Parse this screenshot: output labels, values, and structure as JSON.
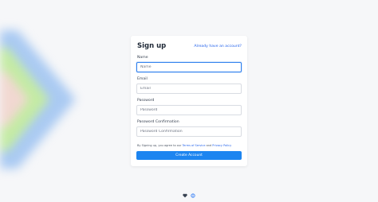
{
  "form": {
    "title": "Sign up",
    "signin_link": "Already have an account?",
    "fields": {
      "name": {
        "label": "Name",
        "placeholder": "Name",
        "value": ""
      },
      "email": {
        "label": "Email",
        "placeholder": "Email",
        "value": ""
      },
      "password": {
        "label": "Password",
        "placeholder": "Password",
        "value": ""
      },
      "password_confirmation": {
        "label": "Password Confirmation",
        "placeholder": "Password Confirmation",
        "value": ""
      }
    },
    "terms": {
      "prefix": "By Signing up, you agree to our ",
      "tos_link": "Terms of Service",
      "conjunction": " and ",
      "privacy_link": "Privacy Policy"
    },
    "submit_label": "Create Account"
  },
  "footer": {
    "icons": [
      "heart-icon",
      "globe-icon"
    ]
  },
  "colors": {
    "accent": "#1d85f0",
    "link": "#2563eb",
    "background": "#f6f7f9",
    "deco_blue": "#7fb3ee",
    "deco_green": "#c8ef9c",
    "deco_pink": "#f6d6d6"
  }
}
